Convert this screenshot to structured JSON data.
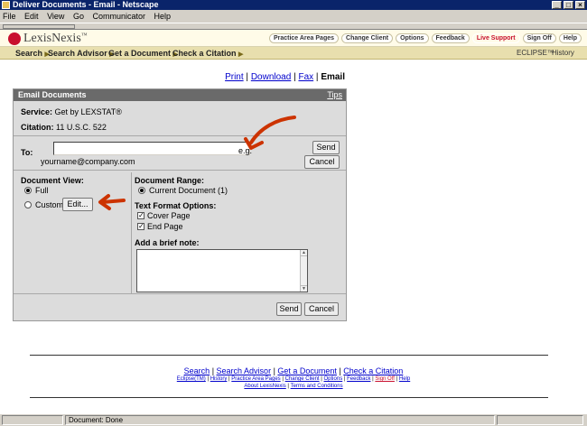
{
  "window": {
    "title": "Deliver Documents - Email - Netscape",
    "buttons": [
      "_",
      "□",
      "×"
    ]
  },
  "menu": [
    "File",
    "Edit",
    "View",
    "Go",
    "Communicator",
    "Help"
  ],
  "brand": {
    "name": "LexisNexis",
    "trademark": "™",
    "logo_color": "#c8102e"
  },
  "top_links": [
    "Practice Area Pages",
    "Change Client",
    "Options",
    "Feedback",
    "Live Support",
    "Sign Off",
    "Help"
  ],
  "nav": {
    "items": [
      "Search",
      "Search Advisor",
      "Get a Document",
      "Check a Citation"
    ],
    "right": [
      "ECLIPSE™",
      "History"
    ]
  },
  "actions": {
    "links": [
      "Print",
      "Download",
      "Fax"
    ],
    "current": "Email"
  },
  "email": {
    "header": "Email Documents",
    "tips": "Tips",
    "service_label": "Service:",
    "service_value": "Get by LEXSTAT®",
    "citation_label": "Citation:",
    "citation_value": "11 U.S.C. 522",
    "to_label": "To:",
    "to_value": "",
    "eg": "e.g.",
    "example": "yourname@company.com",
    "send": "Send",
    "cancel": "Cancel",
    "view_label": "Document View:",
    "full": "Full",
    "custom": "Custom",
    "edit": "Edit...",
    "range_label": "Document Range:",
    "range_value": "Current Document (1)",
    "format_label": "Text Format Options:",
    "cover": "Cover Page",
    "end": "End Page",
    "note_label": "Add a brief note:",
    "note_value": ""
  },
  "footer": {
    "main": [
      "Search",
      "Search Advisor",
      "Get a Document",
      "Check a Citation"
    ],
    "secondary": [
      "Eclipse(TM)",
      "History",
      "Practice Area Pages",
      "Change Client",
      "Options",
      "Feedback",
      "Sign Off",
      "Help"
    ],
    "tertiary": [
      "About LexisNexis",
      "Terms and Conditions"
    ]
  },
  "status": {
    "text": "Document: Done"
  },
  "colors": {
    "arrow": "#cc3300",
    "panel_header": "#6a6a6a",
    "nav_bg": "#e8dfae"
  }
}
